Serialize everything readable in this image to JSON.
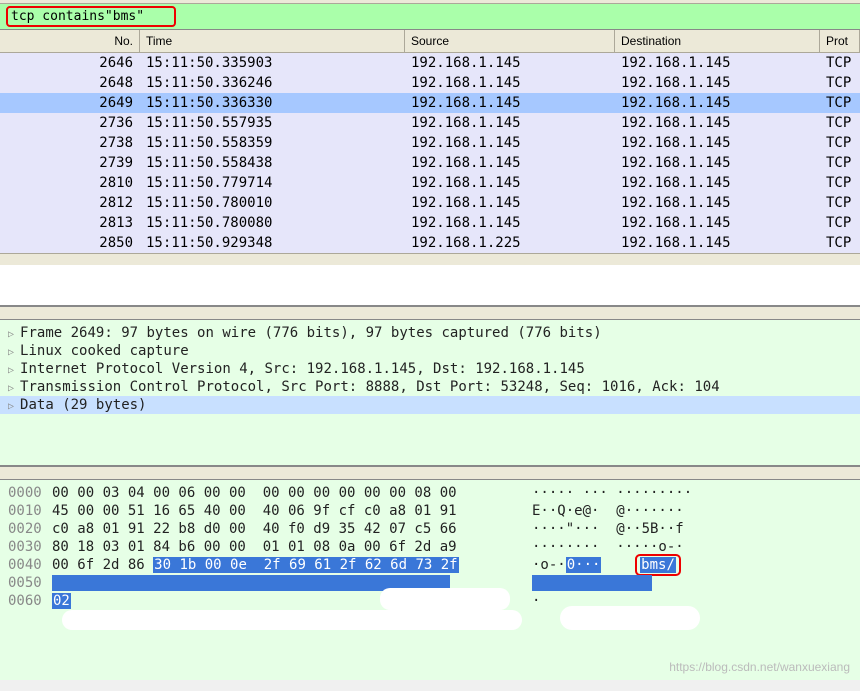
{
  "filter": {
    "value": "tcp contains\"bms\""
  },
  "columns": {
    "no": "No.",
    "time": "Time",
    "src": "Source",
    "dst": "Destination",
    "proto": "Prot"
  },
  "packets": [
    {
      "no": "2646",
      "time": "15:11:50.335903",
      "src": "192.168.1.145",
      "dst": "192.168.1.145",
      "proto": "TCP",
      "sel": false
    },
    {
      "no": "2648",
      "time": "15:11:50.336246",
      "src": "192.168.1.145",
      "dst": "192.168.1.145",
      "proto": "TCP",
      "sel": false
    },
    {
      "no": "2649",
      "time": "15:11:50.336330",
      "src": "192.168.1.145",
      "dst": "192.168.1.145",
      "proto": "TCP",
      "sel": true
    },
    {
      "no": "2736",
      "time": "15:11:50.557935",
      "src": "192.168.1.145",
      "dst": "192.168.1.145",
      "proto": "TCP",
      "sel": false
    },
    {
      "no": "2738",
      "time": "15:11:50.558359",
      "src": "192.168.1.145",
      "dst": "192.168.1.145",
      "proto": "TCP",
      "sel": false
    },
    {
      "no": "2739",
      "time": "15:11:50.558438",
      "src": "192.168.1.145",
      "dst": "192.168.1.145",
      "proto": "TCP",
      "sel": false
    },
    {
      "no": "2810",
      "time": "15:11:50.779714",
      "src": "192.168.1.145",
      "dst": "192.168.1.145",
      "proto": "TCP",
      "sel": false
    },
    {
      "no": "2812",
      "time": "15:11:50.780010",
      "src": "192.168.1.145",
      "dst": "192.168.1.145",
      "proto": "TCP",
      "sel": false
    },
    {
      "no": "2813",
      "time": "15:11:50.780080",
      "src": "192.168.1.145",
      "dst": "192.168.1.145",
      "proto": "TCP",
      "sel": false
    },
    {
      "no": "2850",
      "time": "15:11:50.929348",
      "src": "192.168.1.225",
      "dst": "192.168.1.145",
      "proto": "TCP",
      "sel": false
    }
  ],
  "details": [
    {
      "text": "Frame 2649: 97 bytes on wire (776 bits), 97 bytes captured (776 bits)",
      "sel": false
    },
    {
      "text": "Linux cooked capture",
      "sel": false
    },
    {
      "text": "Internet Protocol Version 4, Src: 192.168.1.145, Dst: 192.168.1.145",
      "sel": false
    },
    {
      "text": "Transmission Control Protocol, Src Port: 8888, Dst Port: 53248, Seq: 1016, Ack: 104",
      "sel": false
    },
    {
      "text": "Data (29 bytes)",
      "sel": true
    }
  ],
  "hex": [
    {
      "off": "0000",
      "b": "00 00 03 04 00 06 00 00  00 00 00 00 00 00 08 00",
      "a": "····· ··· ·········"
    },
    {
      "off": "0010",
      "b": "45 00 00 51 16 65 40 00  40 06 9f cf c0 a8 01 91",
      "a": "E··Q·e@·  @·······"
    },
    {
      "off": "0020",
      "b": "c0 a8 01 91 22 b8 d0 00  40 f0 d9 35 42 07 c5 66",
      "a": "····\"···  @··5B··f"
    },
    {
      "off": "0030",
      "b": "80 18 03 01 84 b6 00 00  01 01 08 0a 00 6f 2d a9",
      "a": "········  ·····o-·"
    }
  ],
  "hex40": {
    "off": "0040",
    "plain": "00 6f 2d 86 ",
    "hl": "30 1b 00 0e  2f 69 61 2f 62 6d 73 2f",
    "aplain": "·o-·",
    "ahl1": "0···",
    "ahl2": "bms/"
  },
  "hex50": {
    "off": "0050",
    "hl": "                                               ",
    "ahl": "              "
  },
  "hex60": {
    "off": "0060",
    "hl": "02",
    "a": "·"
  },
  "watermark": "https://blog.csdn.net/wanxuexiang"
}
